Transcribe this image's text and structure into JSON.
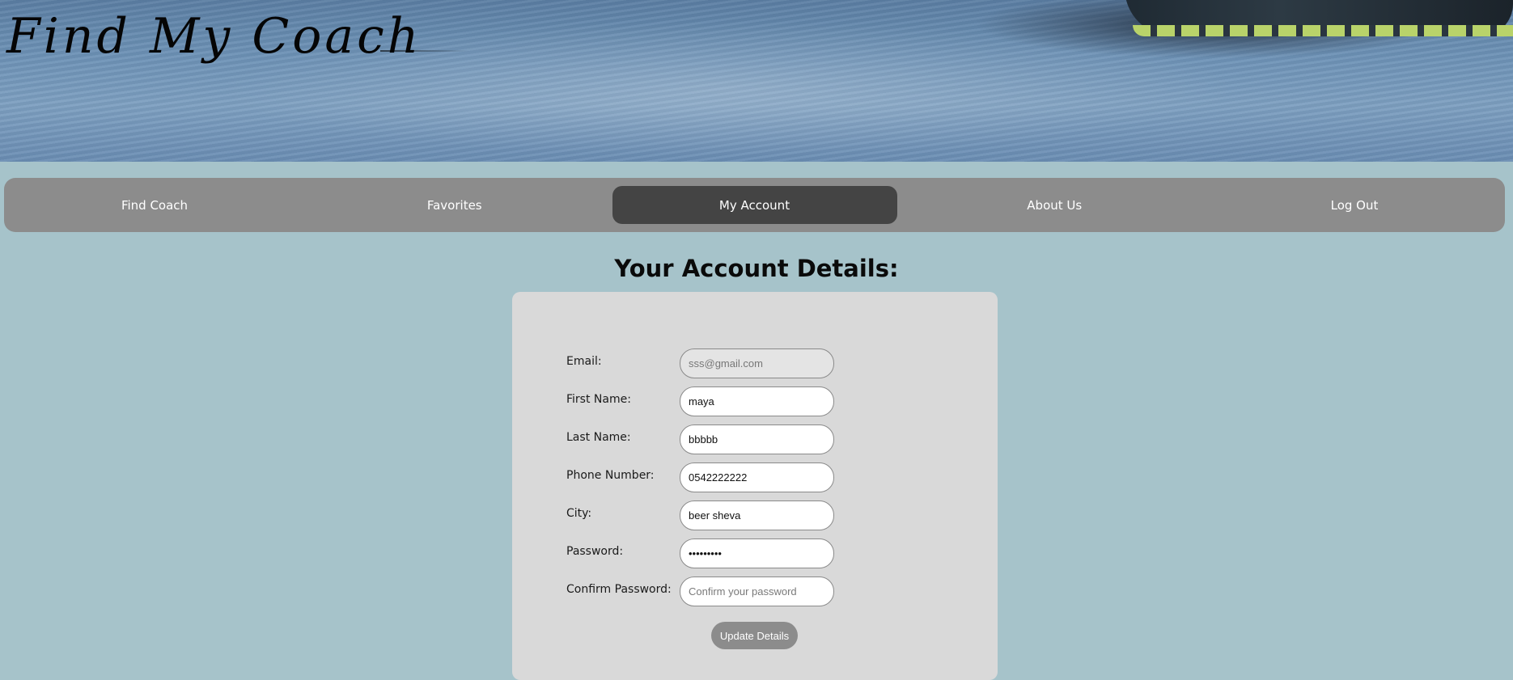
{
  "header": {
    "site_title": "Find My Coach"
  },
  "nav": {
    "items": [
      {
        "label": "Find Coach"
      },
      {
        "label": "Favorites"
      },
      {
        "label": "My Account"
      },
      {
        "label": "About Us"
      },
      {
        "label": "Log Out"
      }
    ],
    "active": "My Account"
  },
  "main": {
    "heading": "Your Account Details:"
  },
  "form": {
    "email": {
      "label": "Email:",
      "value": "sss@gmail.com",
      "disabled": true
    },
    "first_name": {
      "label": "First Name:",
      "value": "maya"
    },
    "last_name": {
      "label": "Last Name:",
      "value": "bbbbb"
    },
    "phone": {
      "label": "Phone Number:",
      "value": "0542222222"
    },
    "city": {
      "label": "City:",
      "value": "beer sheva"
    },
    "password": {
      "label": "Password:",
      "value": "sssssssss"
    },
    "confirm_password": {
      "label": "Confirm Password:",
      "value": "",
      "placeholder": "Confirm your password"
    },
    "submit_label": "Update Details"
  },
  "colors": {
    "page_background": "#a6c3ca",
    "navbar": "#8c8c8c",
    "nav_active": "#444444",
    "card": "#d9d9d9",
    "button": "#8c8c8c"
  }
}
